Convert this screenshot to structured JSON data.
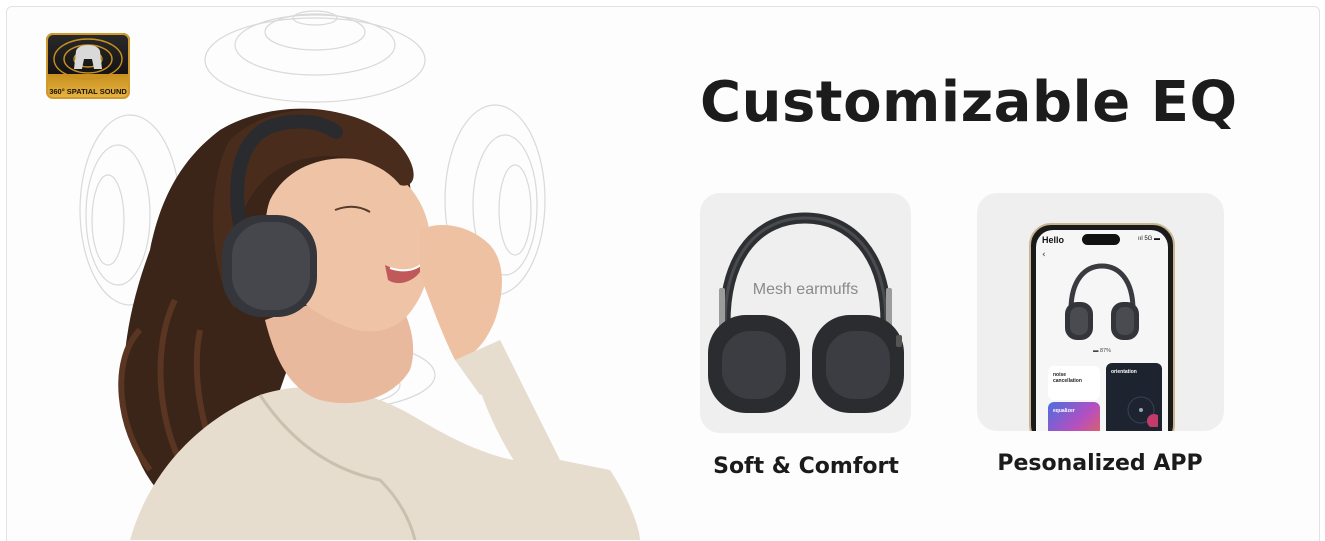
{
  "badge": {
    "text": "360° SPATIAL SOUND",
    "icon": "spatial-sound-icon",
    "colors": {
      "dark": "#141414",
      "gold": "#d19a2c"
    }
  },
  "hero": {
    "image": "woman-wearing-headphones",
    "sound_waves": "sound-wave-rings"
  },
  "heading": "Customizable EQ",
  "features": [
    {
      "note": "Mesh earmuffs",
      "label": "Soft & Comfort",
      "image": "headphones-product"
    },
    {
      "label": "Pesonalized APP",
      "image": "phone-app"
    }
  ],
  "app_screen": {
    "greeting": "Hello",
    "status": "ııl 5G ▬",
    "back": "‹",
    "battery": "▬ 87%",
    "tiles": {
      "noise": "noise\ncancellation",
      "orientation": "orientation",
      "equalizer": "equalizer"
    }
  },
  "colors": {
    "heading": "#1c1c1c",
    "card_bg": "#efefef",
    "headphone": "#2e2f33"
  }
}
